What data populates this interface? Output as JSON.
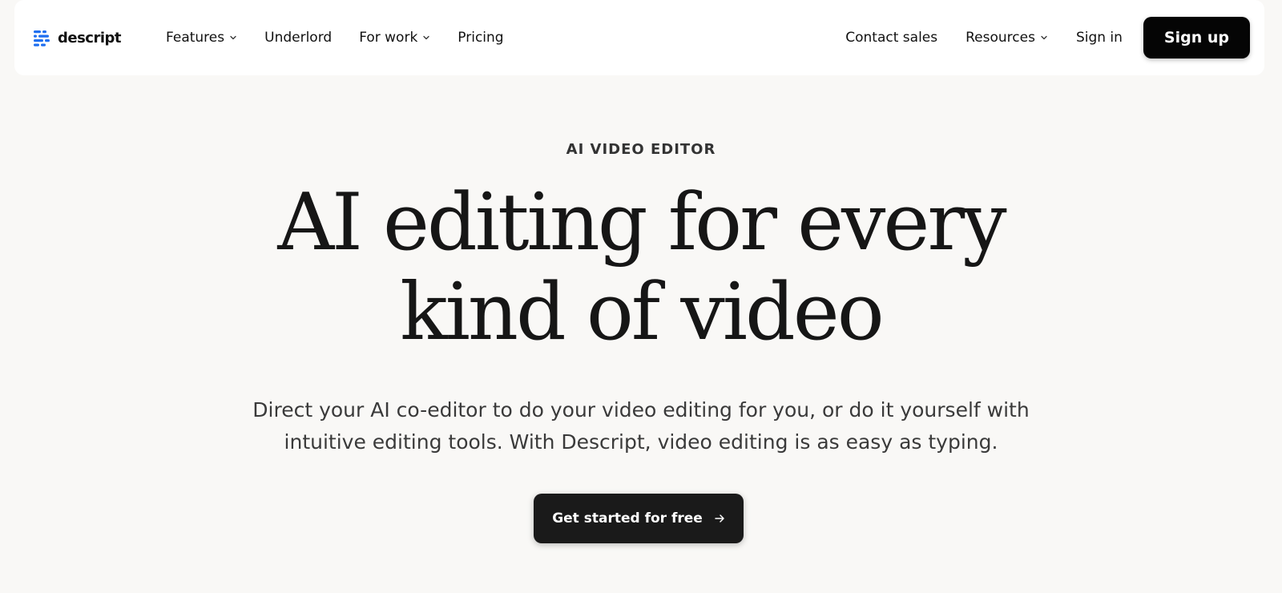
{
  "brand": {
    "name": "descript",
    "accent": "#1f6ff0"
  },
  "nav": {
    "left": [
      {
        "label": "Features",
        "has_menu": true
      },
      {
        "label": "Underlord",
        "has_menu": false
      },
      {
        "label": "For work",
        "has_menu": true
      },
      {
        "label": "Pricing",
        "has_menu": false
      }
    ],
    "right": [
      {
        "label": "Contact sales",
        "has_menu": false
      },
      {
        "label": "Resources",
        "has_menu": true
      },
      {
        "label": "Sign in",
        "has_menu": false
      }
    ],
    "signup_label": "Sign up",
    "icons": {
      "menu": "chevron-down-icon",
      "logo": "descript-logo-icon"
    }
  },
  "hero": {
    "eyebrow": "AI VIDEO EDITOR",
    "headline_line1": "AI editing for every",
    "headline_line2": "kind of video",
    "subhead_line1": "Direct your AI co-editor to do your video editing for you, or do it yourself with",
    "subhead_line2": "intuitive editing tools. With Descript, video editing is as easy as typing.",
    "cta_label": "Get started for free",
    "cta_icon": "arrow-right-icon"
  },
  "colors": {
    "page_bg": "#f9f8f6",
    "nav_bg": "#ffffff",
    "primary_button": "#050505",
    "cta_button": "#1a1a1a"
  }
}
